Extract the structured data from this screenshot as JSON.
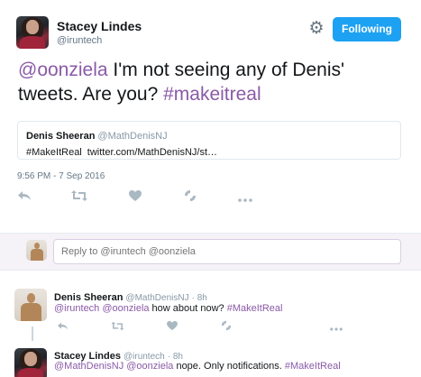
{
  "tweet": {
    "author_name": "Stacey Lindes",
    "author_handle": "@iruntech",
    "follow_label": "Following",
    "text": {
      "mention": "@oonziela",
      "body": " I'm not seeing any of Denis' tweets. Are you? ",
      "hashtag": "#makeitreal"
    },
    "quote": {
      "name": "Denis Sheeran",
      "handle": "@MathDenisNJ",
      "hashtag": "#MakeItReal",
      "link": "twitter.com/MathDenisNJ/st…"
    },
    "timestamp": "9:56 PM - 7 Sep 2016"
  },
  "icons": {
    "gear": "gear-icon",
    "reply": "reply-icon",
    "retweet": "retweet-icon",
    "like": "heart-icon",
    "moments": "moments-icon",
    "more": "more-icon"
  },
  "reply_box": {
    "placeholder": "Reply to @iruntech @oonziela"
  },
  "replies": [
    {
      "name": "Denis Sheeran",
      "handle": "@MathDenisNJ",
      "time": "· 8h",
      "mentions": "@iruntech @oonziela",
      "body": " how about now? ",
      "hashtag": "#MakeItReal"
    },
    {
      "name": "Stacey Lindes",
      "handle": "@iruntech",
      "time": "· 8h",
      "mentions": "@MathDenisNJ @oonziela",
      "body": " nope. Only notifications. ",
      "hashtag": "#MakeItReal"
    }
  ],
  "colors": {
    "accent": "#1da1f2",
    "hashtag": "#8a5aa7",
    "reply_bg": "#f5f2f8"
  }
}
